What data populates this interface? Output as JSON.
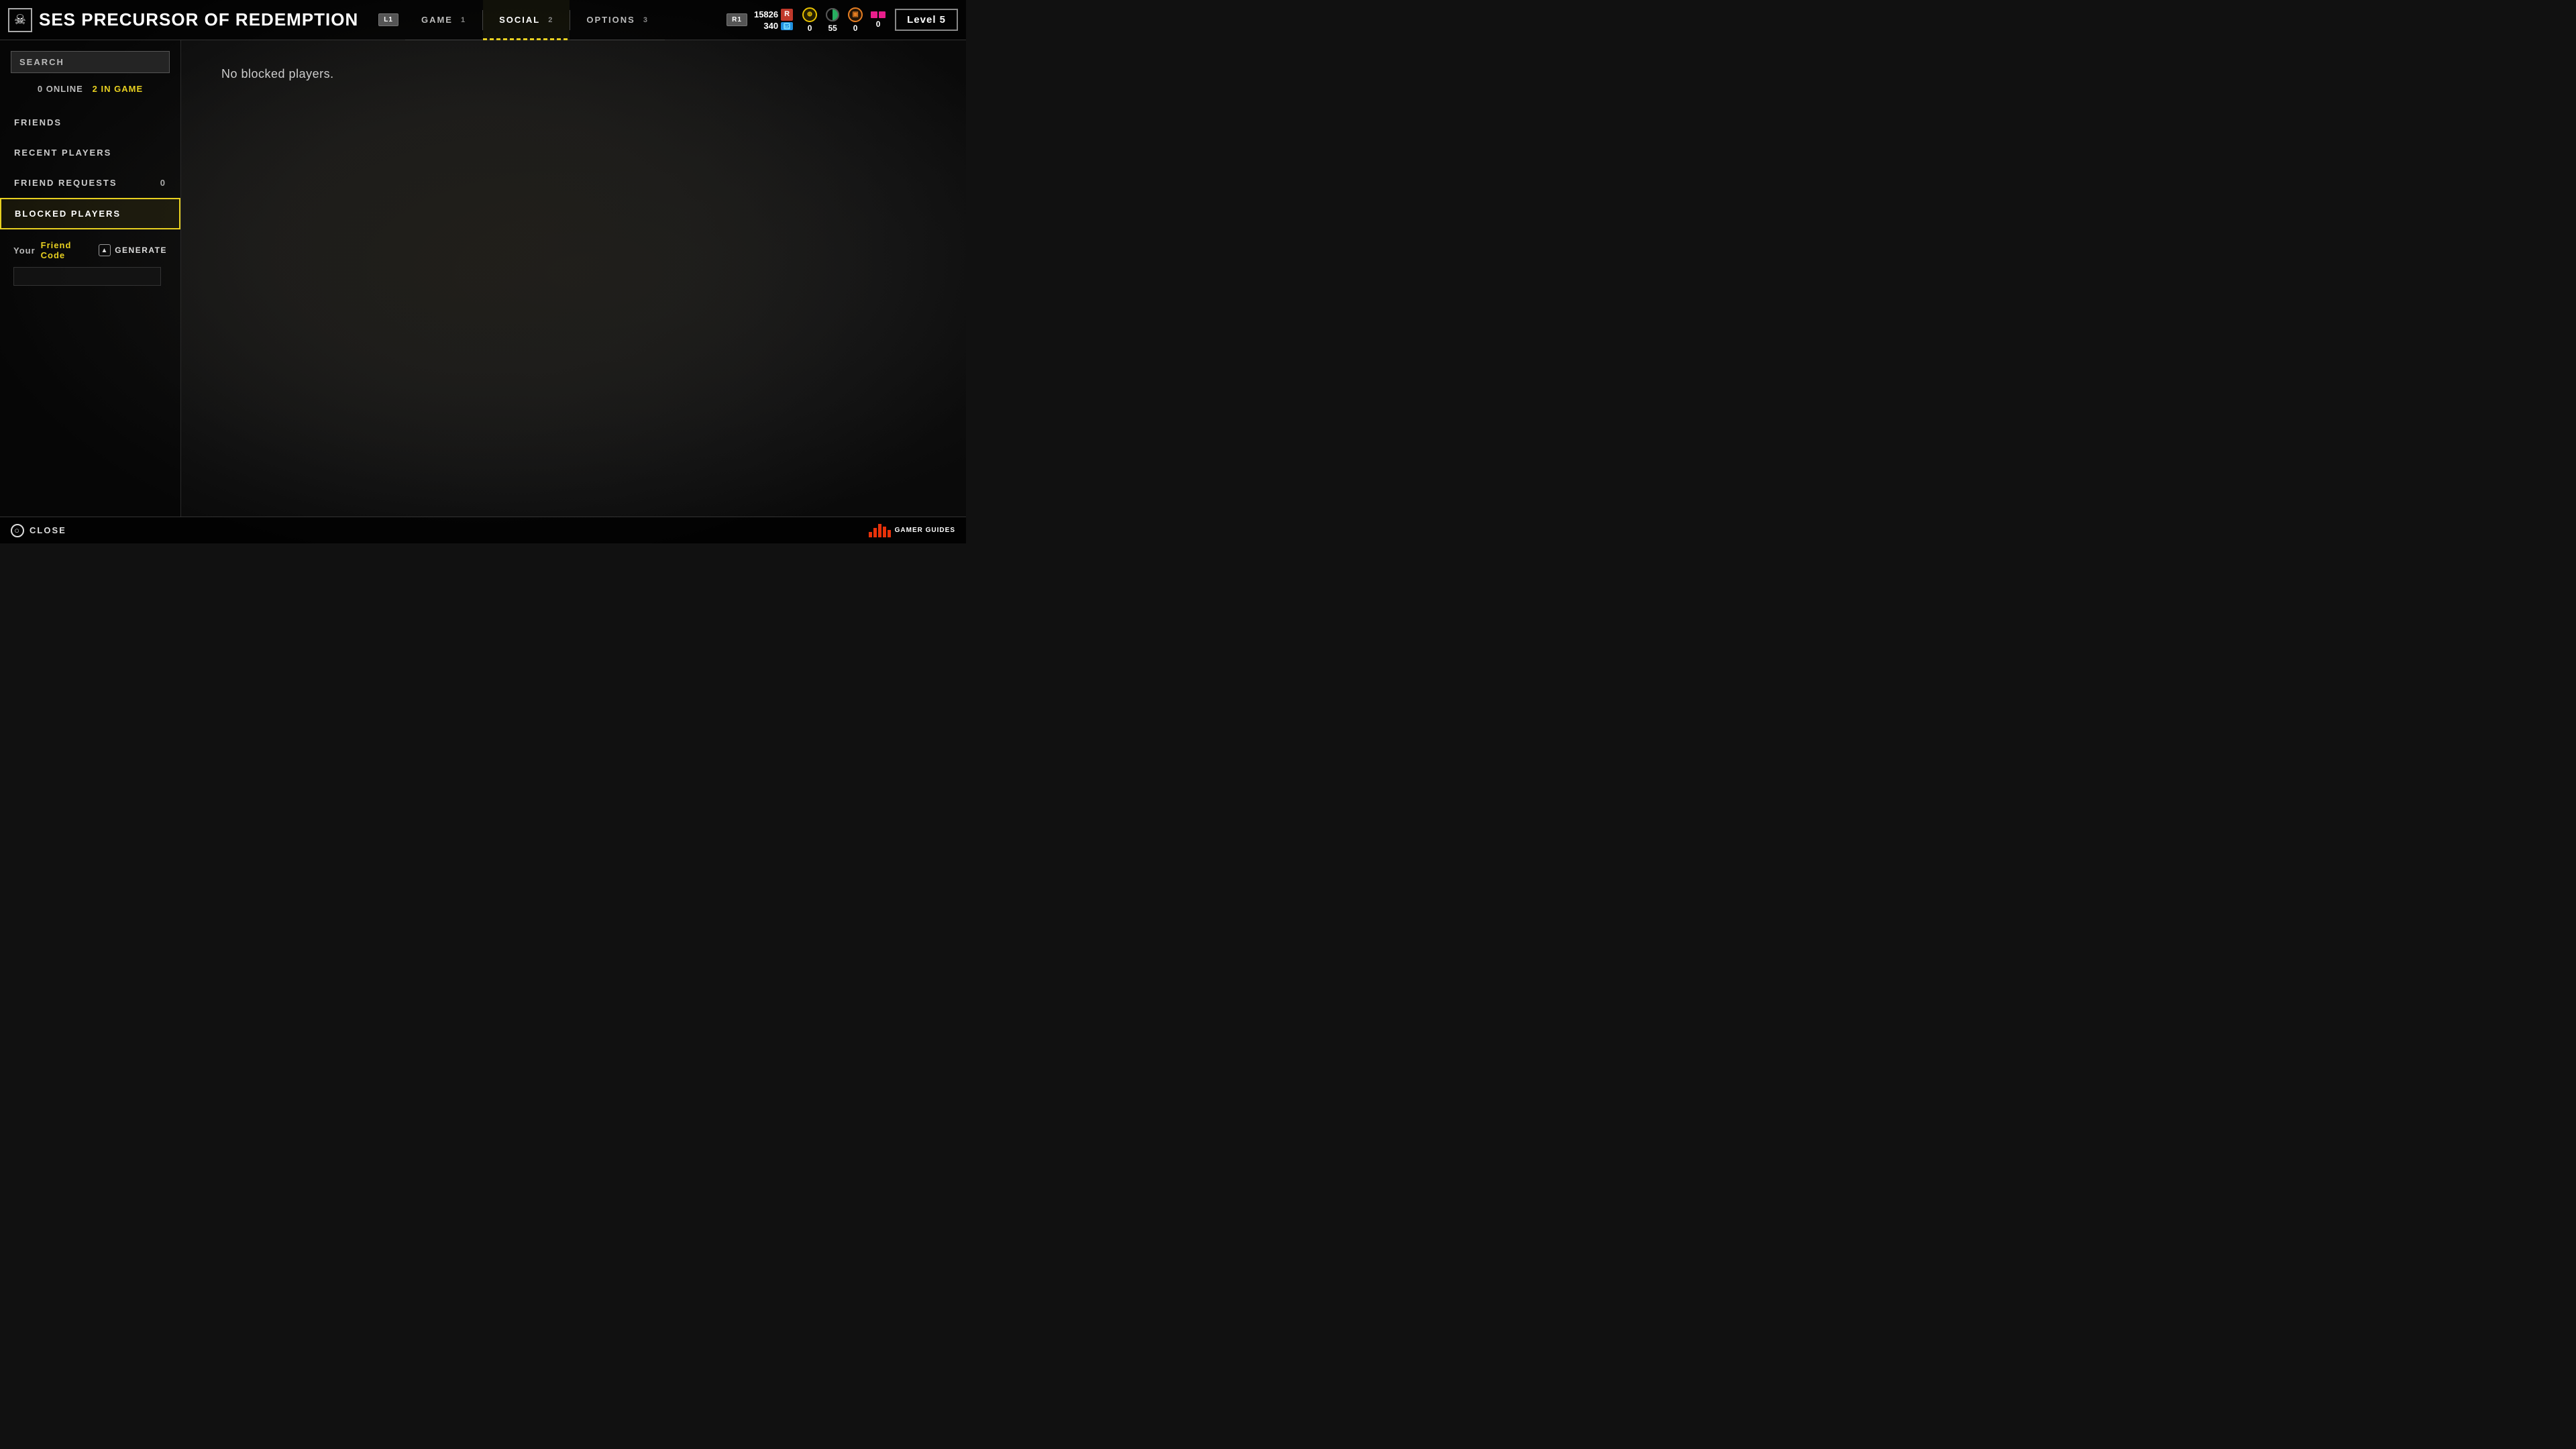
{
  "header": {
    "skull_symbol": "☠",
    "ship_title": "SES Precursor of Redemption",
    "tabs": [
      {
        "id": "game",
        "label": "GAME",
        "num": "1",
        "active": false
      },
      {
        "id": "social",
        "label": "SOCIAL",
        "num": "2",
        "active": true
      },
      {
        "id": "options",
        "label": "OPTIONS",
        "num": "3",
        "active": false
      }
    ],
    "shoulder_left": "L1",
    "shoulder_right": "R1"
  },
  "hud": {
    "currency1_value": "15826",
    "currency1_icon": "R",
    "currency2_value": "340",
    "currency2_icon": "SC",
    "icon1_label": "⊙",
    "icon1_value": "0",
    "icon2_value": "55",
    "icon3_value": "0",
    "icon4_value": "0",
    "level_label": "Level 5"
  },
  "sidebar": {
    "search_placeholder": "SEARCH",
    "online_count": "0 ONLINE",
    "ingame_count": "2 IN GAME",
    "nav_items": [
      {
        "id": "friends",
        "label": "FRIENDS",
        "badge": null,
        "selected": false
      },
      {
        "id": "recent",
        "label": "RECENT PLAYERS",
        "badge": null,
        "selected": false
      },
      {
        "id": "requests",
        "label": "FRIEND REQUESTS",
        "badge": "0",
        "selected": false
      },
      {
        "id": "blocked",
        "label": "BLOCKED PLAYERS",
        "badge": null,
        "selected": true
      }
    ],
    "friend_code_prefix": "Your ",
    "friend_code_label": "Friend Code",
    "generate_label": "GENERATE",
    "triangle_symbol": "▲"
  },
  "main": {
    "no_blocked_text": "No blocked players."
  },
  "footer": {
    "close_label": "CLOSE",
    "circle_symbol": "○",
    "gamer_guides_label": "GAMER GUIDES"
  }
}
